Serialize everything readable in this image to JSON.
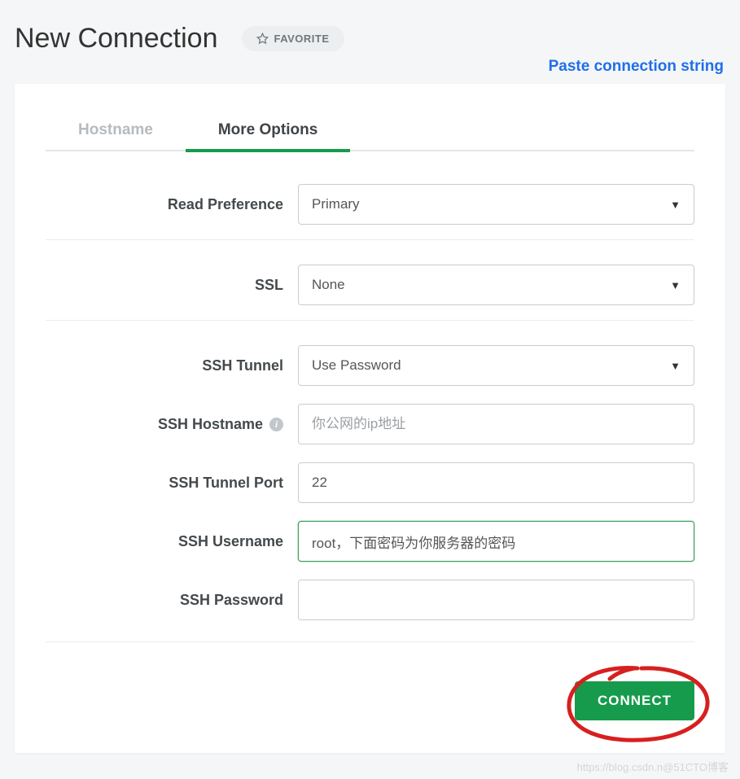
{
  "header": {
    "title": "New Connection",
    "favorite_label": "FAVORITE",
    "paste_link": "Paste connection string"
  },
  "tabs": {
    "hostname": "Hostname",
    "more_options": "More Options"
  },
  "form": {
    "read_preference": {
      "label": "Read Preference",
      "value": "Primary"
    },
    "ssl": {
      "label": "SSL",
      "value": "None"
    },
    "ssh_tunnel": {
      "label": "SSH Tunnel",
      "value": "Use Password"
    },
    "ssh_hostname": {
      "label": "SSH Hostname",
      "placeholder": "你公网的ip地址",
      "value": ""
    },
    "ssh_tunnel_port": {
      "label": "SSH Tunnel Port",
      "value": "22"
    },
    "ssh_username": {
      "label": "SSH Username",
      "value": "root，下面密码为你服务器的密码"
    },
    "ssh_password": {
      "label": "SSH Password",
      "value": ""
    }
  },
  "buttons": {
    "connect": "CONNECT"
  },
  "watermark": "https://blog.csdn.n@51CTO博客"
}
